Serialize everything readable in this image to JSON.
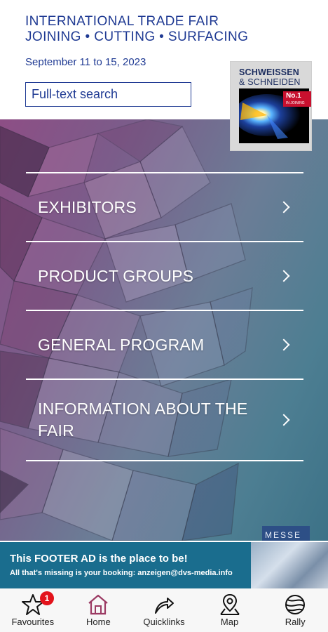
{
  "header": {
    "title_line1": "INTERNATIONAL TRADE FAIR",
    "title_line2": "JOINING • CUTTING • SURFACING",
    "dates": "September 11 to 15, 2023",
    "search_placeholder": "Full-text search"
  },
  "logo": {
    "line1": "SCHWEISSEN",
    "line2": "& SCHNEIDEN",
    "badge": "No.1",
    "badge_sub": "IN JOINING"
  },
  "menu": {
    "items": [
      {
        "label": "EXHIBITORS"
      },
      {
        "label": "PRODUCT GROUPS"
      },
      {
        "label": "GENERAL PROGRAM"
      },
      {
        "label": "INFORMATION ABOUT THE FAIR"
      }
    ]
  },
  "messe_label": "MESSE",
  "footer_ad": {
    "headline": "This FOOTER AD is the place to be!",
    "subtext": "All that's missing is your booking: anzeigen@dvs-media.info"
  },
  "nav": {
    "items": [
      {
        "label": "Favourites",
        "icon": "star-icon",
        "badge": "1"
      },
      {
        "label": "Home",
        "icon": "home-icon"
      },
      {
        "label": "Quicklinks",
        "icon": "quicklinks-arrow-icon"
      },
      {
        "label": "Map",
        "icon": "map-pin-icon"
      },
      {
        "label": "Rally",
        "icon": "rally-globe-icon"
      }
    ]
  },
  "colors": {
    "brand_blue": "#1f3a93",
    "ad_bg": "#1a6d8e",
    "home_active": "#9b3a63",
    "badge_red": "#e3131b"
  }
}
